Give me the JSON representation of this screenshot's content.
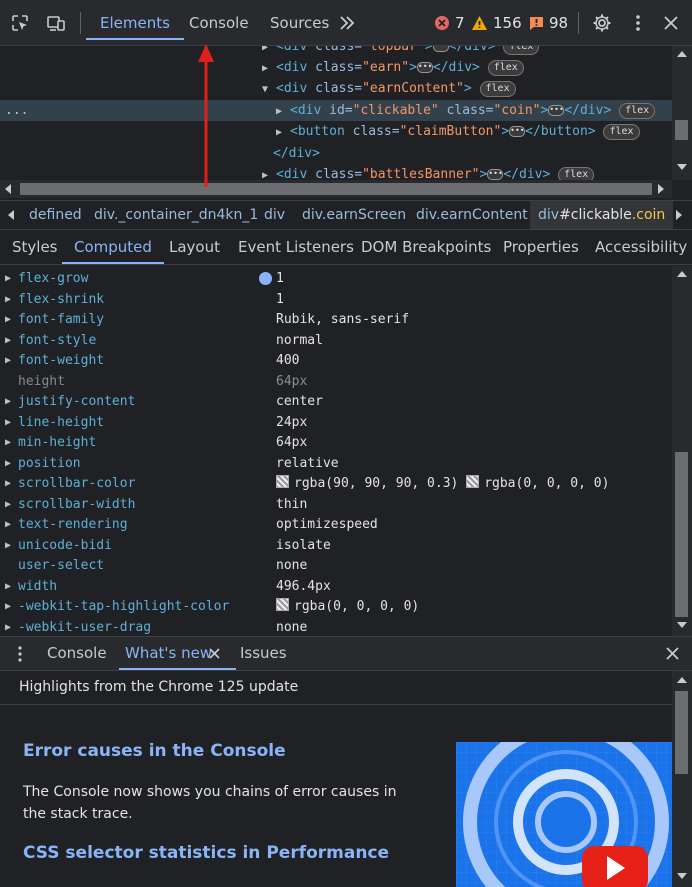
{
  "toolbar": {
    "tabs": [
      {
        "label": "Elements",
        "active": true
      },
      {
        "label": "Console",
        "active": false
      },
      {
        "label": "Sources",
        "active": false
      }
    ],
    "more_tabs_icon": "chevron-double-right-icon",
    "errors": "7",
    "warnings": "156",
    "issues": "98",
    "colors": {
      "accent": "#8ab4f8",
      "error": "#e46962",
      "warning": "#f2a600",
      "issue": "#f28b54"
    }
  },
  "dom_tree": {
    "lines": [
      {
        "open": "<div",
        "attr1": " class=",
        "val1": "\"topBar\"",
        "close": ">",
        "end": "</div>",
        "badge": "flex"
      },
      {
        "open": "<div",
        "attr1": " class=",
        "val1": "\"earn\"",
        "close": ">",
        "end": "</div>",
        "badge": "flex"
      },
      {
        "open": "<div",
        "attr1": " class=",
        "val1": "\"earnContent\"",
        "close": ">",
        "badge": "flex"
      },
      {
        "open": "<div",
        "attr1": " id=",
        "val1": "\"clickable\"",
        "attr2": " class=",
        "val2": "\"coin\"",
        "close": ">",
        "end": "</div>",
        "badge": "flex"
      },
      {
        "open": "<button",
        "attr1": " class=",
        "val1": "\"claimButton\"",
        "close": ">",
        "end": "</button>",
        "badge": "flex"
      },
      {
        "text": "</div>"
      },
      {
        "open": "<div",
        "attr1": " class=",
        "val1": "\"battlesBanner\"",
        "close": ">",
        "end": "</div>",
        "badge": "flex"
      }
    ],
    "selected_gutter": "..."
  },
  "breadcrumbs": [
    {
      "label": "defined"
    },
    {
      "label": "div._container_dn4kn_1"
    },
    {
      "label": "div"
    },
    {
      "label": "div.earnScreen"
    },
    {
      "label": "div.earnContent"
    },
    {
      "tag": "div",
      "id": "#clickable",
      "cls": ".coin"
    }
  ],
  "subtabs": [
    {
      "label": "Styles",
      "active": false
    },
    {
      "label": "Computed",
      "active": true
    },
    {
      "label": "Layout",
      "active": false
    },
    {
      "label": "Event Listeners",
      "active": false
    },
    {
      "label": "DOM Breakpoints",
      "active": false
    },
    {
      "label": "Properties",
      "active": false
    },
    {
      "label": "Accessibility",
      "active": false
    }
  ],
  "computed": [
    {
      "name": "flex-grow",
      "value": "1",
      "goto": true
    },
    {
      "name": "flex-shrink",
      "value": "1"
    },
    {
      "name": "font-family",
      "value": "Rubik, sans-serif"
    },
    {
      "name": "font-style",
      "value": "normal"
    },
    {
      "name": "font-weight",
      "value": "400"
    },
    {
      "name": "height",
      "value": "64px",
      "dim": true
    },
    {
      "name": "justify-content",
      "value": "center"
    },
    {
      "name": "line-height",
      "value": "24px"
    },
    {
      "name": "min-height",
      "value": "64px"
    },
    {
      "name": "position",
      "value": "relative"
    },
    {
      "name": "scrollbar-color",
      "value": "rgba(90, 90, 90, 0.3)",
      "value2": "rgba(0, 0, 0, 0)"
    },
    {
      "name": "scrollbar-width",
      "value": "thin"
    },
    {
      "name": "text-rendering",
      "value": "optimizespeed"
    },
    {
      "name": "unicode-bidi",
      "value": "isolate"
    },
    {
      "name": "user-select",
      "value": "none",
      "no_tri": true
    },
    {
      "name": "width",
      "value": "496.4px"
    },
    {
      "name": "-webkit-tap-highlight-color",
      "value": "rgba(0, 0, 0, 0)",
      "swatch": true
    },
    {
      "name": "-webkit-user-drag",
      "value": "none"
    }
  ],
  "drawer": {
    "tabs": [
      {
        "label": "Console",
        "active": false
      },
      {
        "label": "What's new",
        "active": true
      },
      {
        "label": "Issues",
        "active": false
      }
    ]
  },
  "whats_new": {
    "header": "Highlights from the Chrome 125 update",
    "heading1": "Error causes in the Console",
    "text1": "The Console now shows you chains of error causes in the stack trace.",
    "heading2": "CSS selector statistics in Performance"
  }
}
